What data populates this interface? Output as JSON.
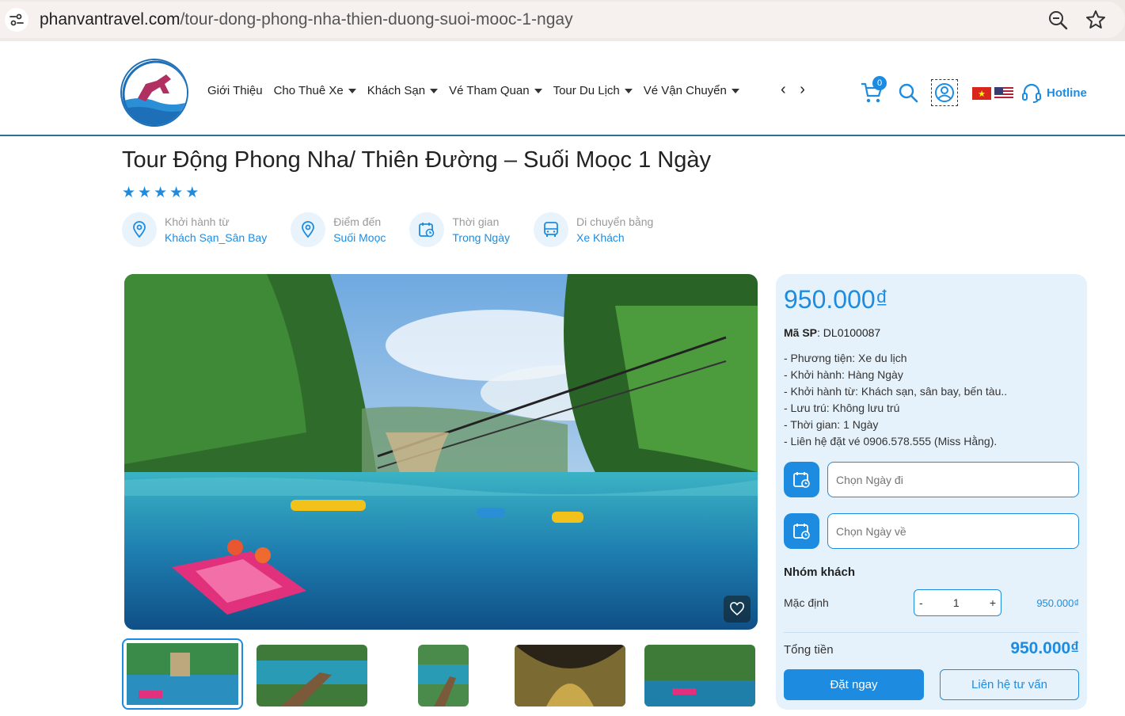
{
  "browser": {
    "url_host": "phanvantravel.com",
    "url_path": "/tour-dong-phong-nha-thien-duong-suoi-mooc-1-ngay",
    "icons": [
      "site-settings-icon",
      "zoom-icon",
      "bookmark-star-icon"
    ]
  },
  "header": {
    "nav": [
      {
        "label": "Giới Thiệu",
        "has_dropdown": false
      },
      {
        "label": "Cho Thuê Xe",
        "has_dropdown": true
      },
      {
        "label": "Khách Sạn",
        "has_dropdown": true
      },
      {
        "label": "Vé Tham Quan",
        "has_dropdown": true
      },
      {
        "label": "Tour Du Lịch",
        "has_dropdown": true
      },
      {
        "label": "Vé Vận Chuyển",
        "has_dropdown": true
      }
    ],
    "nav_arrows": "‹ ›",
    "cart_count": "0",
    "hotline_label": "Hotline",
    "accent_color": "#1d8ce0"
  },
  "product": {
    "title": "Tour Động Phong Nha/ Thiên Đường – Suối Moọc 1 Ngày",
    "rating_stars": 5,
    "info": [
      {
        "label": "Khởi hành từ",
        "value": "Khách Sạn_Sân Bay",
        "icon": "location-pin-icon"
      },
      {
        "label": "Điểm đến",
        "value": "Suối Moọc",
        "icon": "location-pin-icon"
      },
      {
        "label": "Thời gian",
        "value": "Trong Ngày",
        "icon": "calendar-clock-icon"
      },
      {
        "label": "Di chuyển bằng",
        "value": "Xe Khách",
        "icon": "bus-icon"
      }
    ]
  },
  "booking": {
    "price": "950.000₫",
    "sku_label": "Mã SP",
    "sku_value": ": DL0100087",
    "features": [
      "- Phương tiện: Xe du lịch",
      "- Khởi hành: Hàng Ngày",
      "- Khởi hành từ: Khách sạn, sân bay, bến tàu..",
      "- Lưu trú: Không lưu trú",
      "- Thời gian: 1 Ngày",
      "- Liên hệ đặt vé 0906.578.555 (Miss Hằng)."
    ],
    "depart_placeholder": "Chọn Ngày đi",
    "return_placeholder": "Chọn Ngày về",
    "group_title": "Nhóm khách",
    "group_label": "Mặc định",
    "qty_minus": "-",
    "qty_value": "1",
    "qty_plus": "+",
    "group_price": "950.000₫",
    "total_label": "Tổng tiền",
    "total_value": "950.000₫",
    "book_button": "Đặt ngay",
    "contact_button": "Liên hệ tư vấn"
  }
}
